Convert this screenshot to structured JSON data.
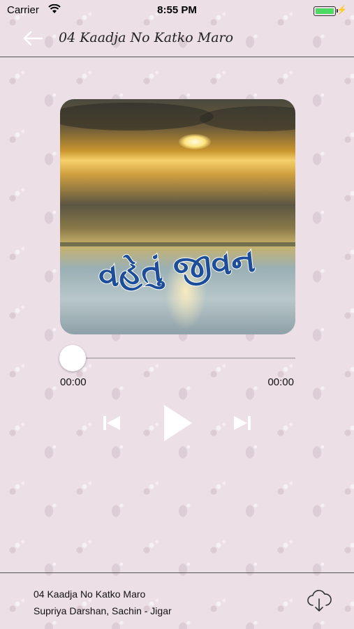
{
  "status_bar": {
    "carrier": "Carrier",
    "time": "8:55 PM"
  },
  "header": {
    "title": "04 Kaadja No Katko Maro"
  },
  "artwork": {
    "caption": "વહેતું જીવન"
  },
  "player": {
    "elapsed": "00:00",
    "total": "00:00",
    "progress": 0
  },
  "now_playing": {
    "title": "04 Kaadja No Katko Maro",
    "artist": "Supriya Darshan, Sachin - Jigar"
  },
  "icons": {
    "back": "back-arrow-icon",
    "prev": "skip-previous-icon",
    "play": "play-icon",
    "next": "skip-next-icon",
    "download": "cloud-download-icon"
  },
  "colors": {
    "battery": "#4cd964",
    "controls": "#ffffff",
    "background": "#ecdfe6"
  }
}
